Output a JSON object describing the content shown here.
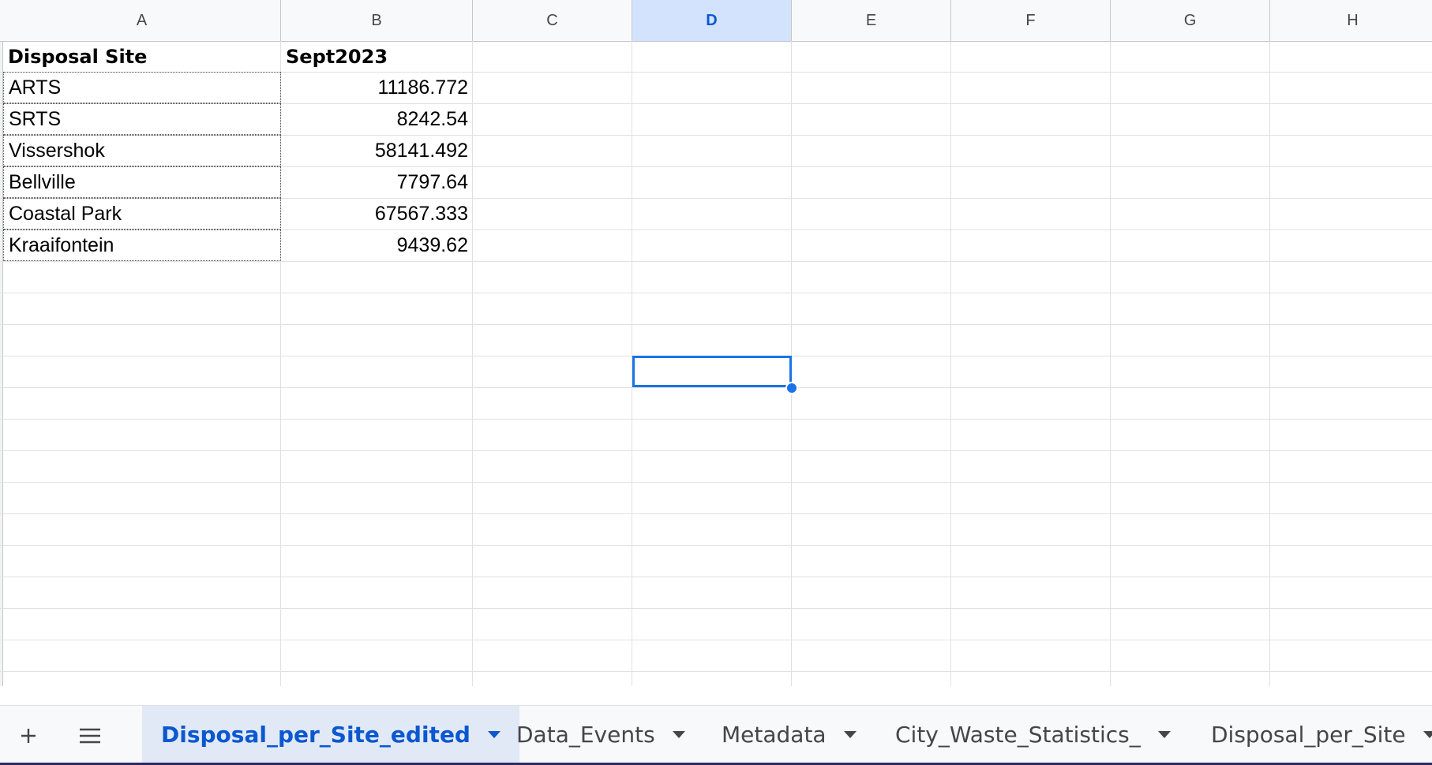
{
  "columns": [
    "A",
    "B",
    "C",
    "D",
    "E",
    "F",
    "G",
    "H"
  ],
  "selected_column": "D",
  "table": {
    "headers": [
      "Disposal Site",
      "Sept2023"
    ],
    "rows": [
      {
        "site": "ARTS",
        "value": "11186.772"
      },
      {
        "site": "SRTS",
        "value": "8242.54"
      },
      {
        "site": "Vissershok",
        "value": "58141.492"
      },
      {
        "site": "Bellville",
        "value": "7797.64"
      },
      {
        "site": "Coastal Park",
        "value": "67567.333"
      },
      {
        "site": "Kraaifontein",
        "value": "9439.62"
      }
    ]
  },
  "sheet_tabs": [
    {
      "label": "Disposal_per_Site_edited",
      "active": true
    },
    {
      "label": "Data_Events",
      "active": false
    },
    {
      "label": "Metadata",
      "active": false
    },
    {
      "label": "City_Waste_Statistics_",
      "active": false
    },
    {
      "label": "Disposal_per_Site",
      "active": false
    }
  ],
  "icons": {
    "add_sheet": "plus-icon",
    "all_sheets": "menu-icon"
  },
  "colors": {
    "accent": "#1a73e8",
    "selected_header_bg": "#d3e3fd",
    "active_tab_text": "#0b57d0"
  }
}
